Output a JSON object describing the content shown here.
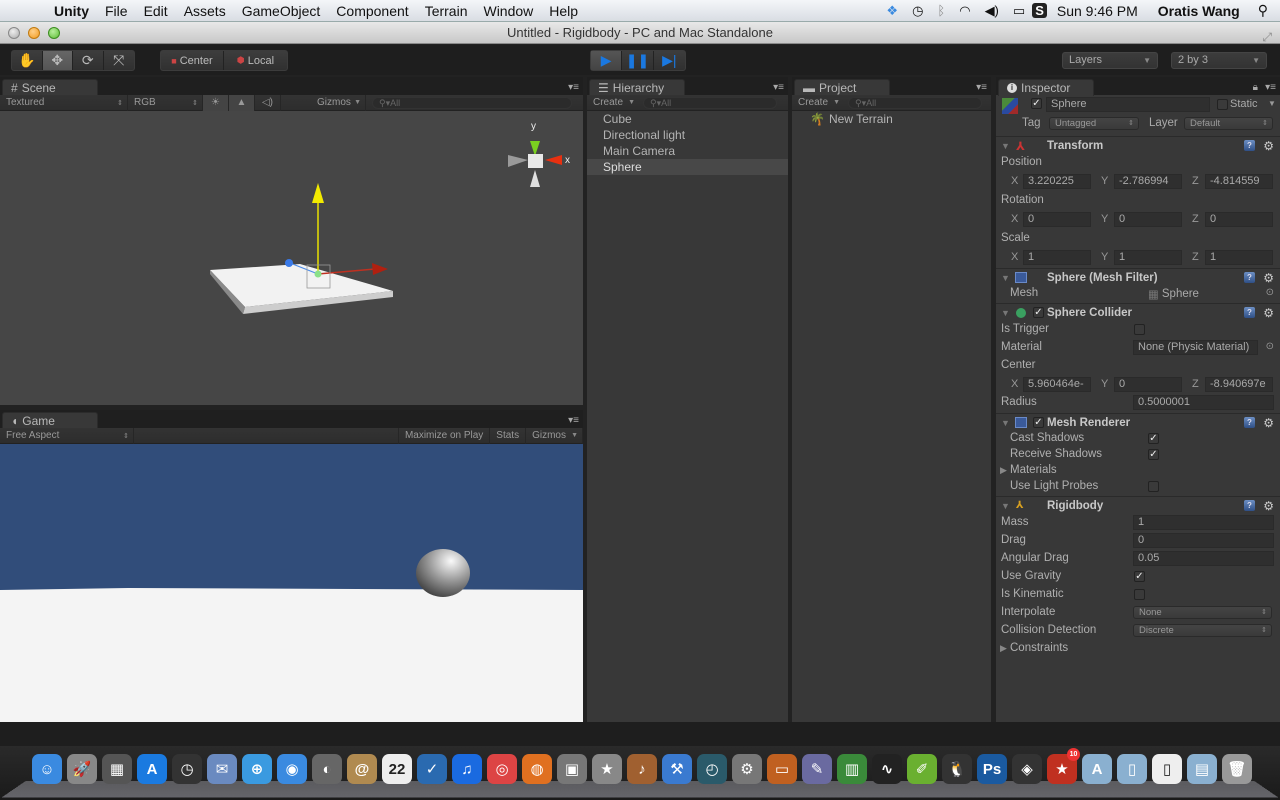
{
  "menubar": {
    "app": "Unity",
    "items": [
      "File",
      "Edit",
      "Assets",
      "GameObject",
      "Component",
      "Terrain",
      "Window",
      "Help"
    ],
    "clock": "Sun 9:46 PM",
    "user": "Oratis Wang",
    "tray_icons": [
      "dropbox-icon",
      "time-machine-icon",
      "bluetooth-icon",
      "wifi-icon",
      "volume-icon",
      "battery-icon",
      "skype-icon"
    ]
  },
  "window": {
    "title": "Untitled - Rigidbody - PC and Mac Standalone"
  },
  "toolbar": {
    "tools": [
      "hand",
      "move",
      "rotate",
      "scale"
    ],
    "pivot_center": "Center",
    "pivot_local": "Local",
    "layers": "Layers",
    "layout": "2 by 3"
  },
  "scene": {
    "tab": "Scene",
    "render_mode": "Textured",
    "channel": "RGB",
    "gizmos": "Gizmos",
    "search_placeholder": "All",
    "gizmo_y": "y",
    "gizmo_x": "x"
  },
  "game": {
    "tab": "Game",
    "aspect": "Free Aspect",
    "maximize": "Maximize on Play",
    "stats": "Stats",
    "gizmos": "Gizmos",
    "colors": {
      "sky": "#314d7a",
      "ground": "#f4f4f4"
    }
  },
  "hierarchy": {
    "tab": "Hierarchy",
    "create": "Create",
    "search_placeholder": "All",
    "items": [
      {
        "label": "Cube",
        "selected": false
      },
      {
        "label": "Directional light",
        "selected": false
      },
      {
        "label": "Main Camera",
        "selected": false
      },
      {
        "label": "Sphere",
        "selected": true
      }
    ]
  },
  "project": {
    "tab": "Project",
    "create": "Create",
    "search_placeholder": "All",
    "items": [
      {
        "label": "New Terrain",
        "icon": "terrain-icon"
      }
    ]
  },
  "inspector": {
    "tab": "Inspector",
    "object_name": "Sphere",
    "active": true,
    "static_label": "Static",
    "static": false,
    "tag_label": "Tag",
    "tag": "Untagged",
    "layer_label": "Layer",
    "layer": "Default",
    "transform": {
      "title": "Transform",
      "position_label": "Position",
      "position": {
        "x": "3.220225",
        "y": "-2.786994",
        "z": "-4.814559"
      },
      "rotation_label": "Rotation",
      "rotation": {
        "x": "0",
        "y": "0",
        "z": "0"
      },
      "scale_label": "Scale",
      "scale": {
        "x": "1",
        "y": "1",
        "z": "1"
      }
    },
    "mesh_filter": {
      "title": "Sphere (Mesh Filter)",
      "mesh_label": "Mesh",
      "mesh": "Sphere"
    },
    "sphere_collider": {
      "title": "Sphere Collider",
      "enabled": true,
      "is_trigger_label": "Is Trigger",
      "is_trigger": false,
      "material_label": "Material",
      "material": "None (Physic Material)",
      "center_label": "Center",
      "center": {
        "x": "5.960464e-",
        "y": "0",
        "z": "-8.940697e"
      },
      "radius_label": "Radius",
      "radius": "0.5000001"
    },
    "mesh_renderer": {
      "title": "Mesh Renderer",
      "enabled": true,
      "cast_shadows_label": "Cast Shadows",
      "cast_shadows": true,
      "receive_shadows_label": "Receive Shadows",
      "receive_shadows": true,
      "materials_label": "Materials",
      "light_probes_label": "Use Light Probes",
      "light_probes": false
    },
    "rigidbody": {
      "title": "Rigidbody",
      "mass_label": "Mass",
      "mass": "1",
      "drag_label": "Drag",
      "drag": "0",
      "angular_drag_label": "Angular Drag",
      "angular_drag": "0.05",
      "use_gravity_label": "Use Gravity",
      "use_gravity": true,
      "is_kinematic_label": "Is Kinematic",
      "is_kinematic": false,
      "interpolate_label": "Interpolate",
      "interpolate": "None",
      "collision_label": "Collision Detection",
      "collision": "Discrete",
      "constraints_label": "Constraints"
    }
  },
  "dock": {
    "apps": [
      {
        "name": "finder",
        "glyph": "☺",
        "color": "#3a8ae0"
      },
      {
        "name": "launchpad",
        "glyph": "🚀",
        "color": "#888"
      },
      {
        "name": "mission-control",
        "glyph": "▦",
        "color": "#555"
      },
      {
        "name": "app-store",
        "glyph": "A",
        "color": "#1a7ae0"
      },
      {
        "name": "dashboard",
        "glyph": "◷",
        "color": "#333"
      },
      {
        "name": "mail",
        "glyph": "✉",
        "color": "#6a8ac0"
      },
      {
        "name": "safari",
        "glyph": "⊕",
        "color": "#3a9ae0"
      },
      {
        "name": "ichat",
        "glyph": "◉",
        "color": "#3a8ae0"
      },
      {
        "name": "facetime",
        "glyph": "◐",
        "color": "#666"
      },
      {
        "name": "address-book",
        "glyph": "@",
        "color": "#b08a50"
      },
      {
        "name": "ical",
        "glyph": "22",
        "color": "#eee"
      },
      {
        "name": "reminders",
        "glyph": "✓",
        "color": "#2a6ab0"
      },
      {
        "name": "itunes",
        "glyph": "♫",
        "color": "#1a6ae0"
      },
      {
        "name": "chrome",
        "glyph": "◎",
        "color": "#d44"
      },
      {
        "name": "firefox",
        "glyph": "◍",
        "color": "#e07020"
      },
      {
        "name": "iphoto",
        "glyph": "▣",
        "color": "#777"
      },
      {
        "name": "imovie",
        "glyph": "★",
        "color": "#888"
      },
      {
        "name": "garageband",
        "glyph": "♪",
        "color": "#a06030"
      },
      {
        "name": "xcode",
        "glyph": "⚒",
        "color": "#3a7ad0"
      },
      {
        "name": "time-machine",
        "glyph": "◴",
        "color": "#2a5a6a"
      },
      {
        "name": "system-preferences",
        "glyph": "⚙",
        "color": "#777"
      },
      {
        "name": "keynote",
        "glyph": "▭",
        "color": "#c06020"
      },
      {
        "name": "script-editor",
        "glyph": "✎",
        "color": "#6a6aa0"
      },
      {
        "name": "numbers",
        "glyph": "▥",
        "color": "#3a8a3a"
      },
      {
        "name": "activity-monitor",
        "glyph": "∿",
        "color": "#222"
      },
      {
        "name": "evernote-notes",
        "glyph": "✐",
        "color": "#6ab030"
      },
      {
        "name": "qq",
        "glyph": "🐧",
        "color": "#333"
      },
      {
        "name": "photoshop",
        "glyph": "Ps",
        "color": "#1a5aa0"
      },
      {
        "name": "unity",
        "glyph": "◈",
        "color": "#333"
      },
      {
        "name": "wunderlist",
        "glyph": "★",
        "color": "#c03020",
        "badge": "10"
      },
      {
        "name": "applications-folder",
        "glyph": "A",
        "color": "#8ab0d0"
      },
      {
        "name": "documents-folder",
        "glyph": "▯",
        "color": "#8ab0d0"
      },
      {
        "name": "file",
        "glyph": "▯",
        "color": "#eee"
      },
      {
        "name": "downloads-folder",
        "glyph": "▤",
        "color": "#8ab0d0"
      },
      {
        "name": "trash",
        "glyph": "🗑",
        "color": "#999"
      }
    ]
  }
}
